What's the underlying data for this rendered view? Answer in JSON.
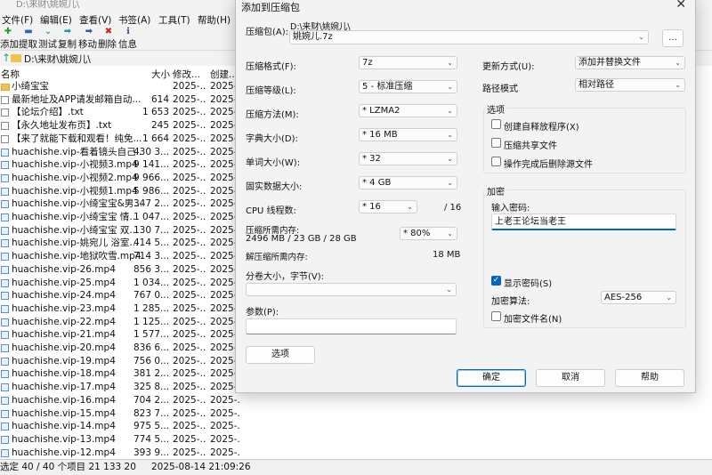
{
  "filemanager": {
    "title": "D:\\来财\\姚婉儿\\",
    "menu": [
      "文件(F)",
      "编辑(E)",
      "查看(V)",
      "书签(A)",
      "工具(T)",
      "帮助(H)"
    ],
    "toolbar": [
      {
        "label": "添加",
        "icon": "add-icon"
      },
      {
        "label": "提取",
        "icon": "extract-icon"
      },
      {
        "label": "测试",
        "icon": "test-icon"
      },
      {
        "label": "复制",
        "icon": "copy-icon"
      },
      {
        "label": "移动",
        "icon": "move-icon"
      },
      {
        "label": "删除",
        "icon": "delete-icon"
      },
      {
        "label": "信息",
        "icon": "info-icon"
      }
    ],
    "path": "D:\\来财\\姚婉儿\\",
    "columns": {
      "name": "名称",
      "size": "大小",
      "modified": "修改...",
      "created": "创建..."
    },
    "files": [
      {
        "name": "小绮宝宝",
        "size": "",
        "modified": "2025-...",
        "created": "2025-...",
        "type": "folder"
      },
      {
        "name": "最新地址及APP请发邮箱自动...",
        "size": "614",
        "modified": "2025-...",
        "created": "2025-...",
        "type": "txt"
      },
      {
        "name": "【论坛介绍】.txt",
        "size": "1 653",
        "modified": "2025-...",
        "created": "2025-...",
        "type": "txt"
      },
      {
        "name": "【永久地址发布页】.txt",
        "size": "245",
        "modified": "2025-...",
        "created": "2025-...",
        "type": "txt"
      },
      {
        "name": "【来了就能下载和观看！纯免...",
        "size": "1 664",
        "modified": "2025-...",
        "created": "2025-...",
        "type": "txt"
      },
      {
        "name": "huachishe.vip-看着镜头自己...",
        "size": "430 3...",
        "modified": "2025-...",
        "created": "2025-...",
        "type": "video"
      },
      {
        "name": "huachishe.vip-小视频3.mp4",
        "size": "9 141...",
        "modified": "2025-...",
        "created": "2025-...",
        "type": "video"
      },
      {
        "name": "huachishe.vip-小视频2.mp4",
        "size": "9 966...",
        "modified": "2025-...",
        "created": "2025-...",
        "type": "video"
      },
      {
        "name": "huachishe.vip-小视频1.mp4",
        "size": "5 986...",
        "modified": "2025-...",
        "created": "2025-...",
        "type": "video"
      },
      {
        "name": "huachishe.vip-小绮宝宝&男...",
        "size": "347 2...",
        "modified": "2025-...",
        "created": "2025-...",
        "type": "video"
      },
      {
        "name": "huachishe.vip-小绮宝宝 情...",
        "size": "1 047...",
        "modified": "2025-...",
        "created": "2025-...",
        "type": "video"
      },
      {
        "name": "huachishe.vip-小绮宝宝 双...",
        "size": "130 7...",
        "modified": "2025-...",
        "created": "2025-...",
        "type": "video"
      },
      {
        "name": "huachishe.vip-姚宛儿 浴室...",
        "size": "414 5...",
        "modified": "2025-...",
        "created": "2025-...",
        "type": "video"
      },
      {
        "name": "huachishe.vip-地狱吹雪.mp4",
        "size": "714 3...",
        "modified": "2025-...",
        "created": "2025-...",
        "type": "video"
      },
      {
        "name": "huachishe.vip-26.mp4",
        "size": "856 3...",
        "modified": "2025-...",
        "created": "2025-...",
        "type": "video"
      },
      {
        "name": "huachishe.vip-25.mp4",
        "size": "1 034...",
        "modified": "2025-...",
        "created": "2025-...",
        "type": "video"
      },
      {
        "name": "huachishe.vip-24.mp4",
        "size": "767 0...",
        "modified": "2025-...",
        "created": "2025-...",
        "type": "video"
      },
      {
        "name": "huachishe.vip-23.mp4",
        "size": "1 285...",
        "modified": "2025-...",
        "created": "2025-...",
        "type": "video"
      },
      {
        "name": "huachishe.vip-22.mp4",
        "size": "1 125...",
        "modified": "2025-...",
        "created": "2025-...",
        "type": "video"
      },
      {
        "name": "huachishe.vip-21.mp4",
        "size": "1 577...",
        "modified": "2025-...",
        "created": "2025-...",
        "type": "video"
      },
      {
        "name": "huachishe.vip-20.mp4",
        "size": "836 6...",
        "modified": "2025-...",
        "created": "2025-...",
        "type": "video"
      },
      {
        "name": "huachishe.vip-19.mp4",
        "size": "756 0...",
        "modified": "2025-...",
        "created": "2025-...",
        "type": "video"
      },
      {
        "name": "huachishe.vip-18.mp4",
        "size": "381 2...",
        "modified": "2025-...",
        "created": "2025-...",
        "type": "video"
      },
      {
        "name": "huachishe.vip-17.mp4",
        "size": "325 8...",
        "modified": "2025-...",
        "created": "2025-...",
        "type": "video"
      },
      {
        "name": "huachishe.vip-16.mp4",
        "size": "704 2...",
        "modified": "2025-...",
        "created": "2025-...",
        "type": "video"
      },
      {
        "name": "huachishe.vip-15.mp4",
        "size": "823 7...",
        "modified": "2025-...",
        "created": "2025-...",
        "type": "video"
      },
      {
        "name": "huachishe.vip-14.mp4",
        "size": "975 5...",
        "modified": "2025-...",
        "created": "2025-...",
        "type": "video"
      },
      {
        "name": "huachishe.vip-13.mp4",
        "size": "774 5...",
        "modified": "2025-...",
        "created": "2025-...",
        "type": "video"
      },
      {
        "name": "huachishe.vip-12.mp4",
        "size": "393 9...",
        "modified": "2025-...",
        "created": "2025-...",
        "type": "video"
      }
    ],
    "status": {
      "selection": "选定 40 / 40 个项目 21 133 20",
      "datetime": "2025-08-14 21:09:26"
    }
  },
  "dialog": {
    "title": "添加到压缩包",
    "archive_label": "压缩包(A):",
    "archive_dir": "D:\\来财\\姚婉儿\\",
    "archive_name": "姚婉儿.7z",
    "browse_label": "...",
    "format_label": "压缩格式(F):",
    "format_value": "7z",
    "level_label": "压缩等级(L):",
    "level_value": "5 - 标准压缩",
    "method_label": "压缩方法(M):",
    "method_value": "* LZMA2",
    "dict_label": "字典大小(D):",
    "dict_value": "* 16 MB",
    "word_label": "单词大小(W):",
    "word_value": "* 32",
    "solid_label": "固实数据大小:",
    "solid_value": "* 4 GB",
    "cpu_label": "CPU 线程数:",
    "cpu_value": "* 16",
    "cpu_total": "/ 16",
    "mem_comp_label": "压缩所需内存:",
    "mem_comp_value": "2496 MB / 23 GB / 28 GB",
    "mem_percent": "* 80%",
    "mem_decomp_label": "解压缩所需内存:",
    "mem_decomp_value": "18 MB",
    "split_label": "分卷大小，字节(V):",
    "split_value": "",
    "params_label": "参数(P):",
    "params_value": "",
    "options_button": "选项",
    "update_label": "更新方式(U):",
    "update_value": "添加并替换文件",
    "pathmode_label": "路径模式",
    "pathmode_value": "相对路径",
    "options_group": "选项",
    "opt_sfx": "创建自释放程序(X)",
    "opt_shared": "压缩共享文件",
    "opt_delete": "操作完成后删除源文件",
    "encrypt_group": "加密",
    "pw_label": "输入密码:",
    "pw_value": "上老王论坛当老王",
    "show_pw": "显示密码(S)",
    "enc_method_label": "加密算法:",
    "enc_method_value": "AES-256",
    "enc_names": "加密文件名(N)",
    "ok": "确定",
    "cancel": "取消",
    "help": "帮助"
  },
  "colors": {
    "accent": "#0067c0",
    "folder": "#f0c44c"
  }
}
